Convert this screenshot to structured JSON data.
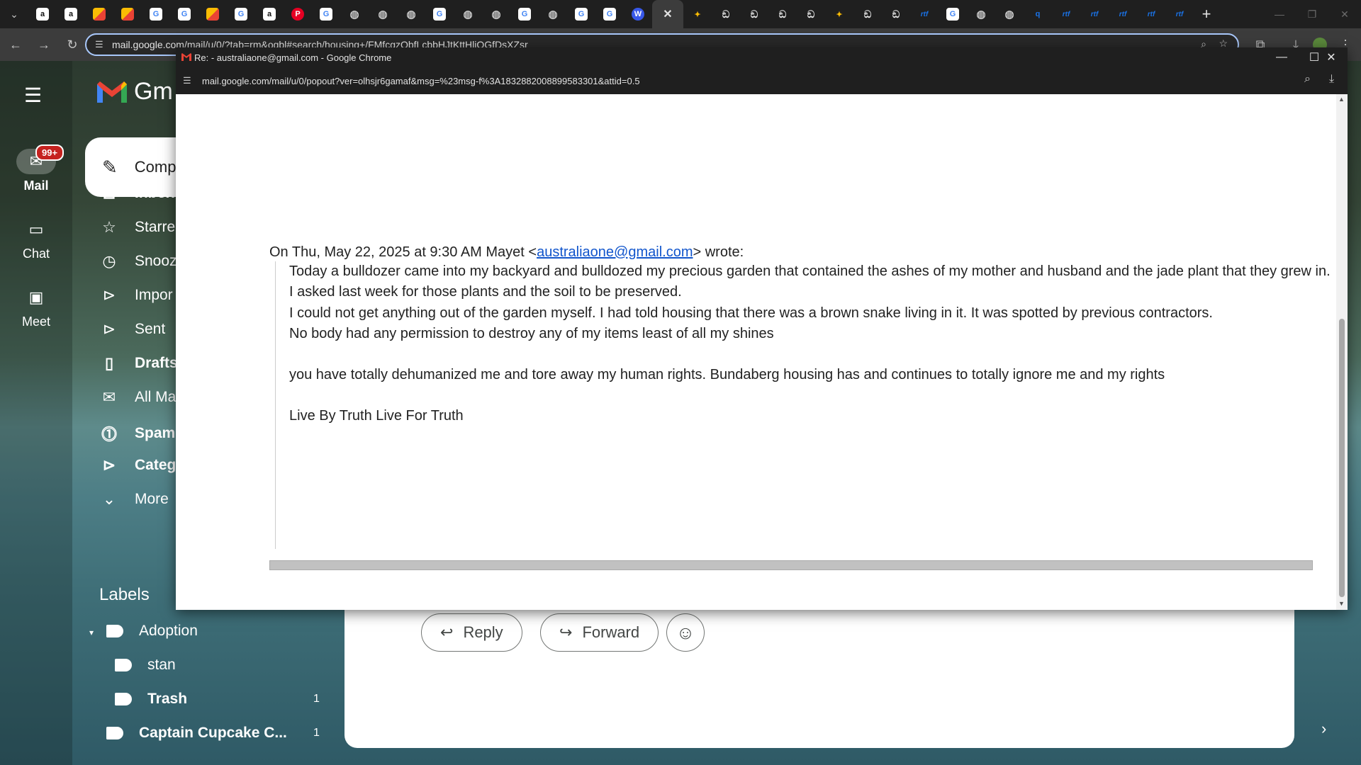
{
  "browser": {
    "tabs": [
      {
        "icon": "amazon-icon",
        "label": "a",
        "color": "#111111"
      },
      {
        "icon": "amazon-icon",
        "label": "a",
        "color": "#111111"
      },
      {
        "icon": "photos-icon",
        "label": "",
        "color": "#f4b400"
      },
      {
        "icon": "photos-icon",
        "label": "",
        "color": "#f4b400"
      },
      {
        "icon": "google-icon",
        "label": "G",
        "color": "#ffffff"
      },
      {
        "icon": "google-icon",
        "label": "G",
        "color": "#ffffff"
      },
      {
        "icon": "photos-icon",
        "label": "",
        "color": "#f4b400"
      },
      {
        "icon": "google-icon",
        "label": "G",
        "color": "#ffffff"
      },
      {
        "icon": "amazon-icon",
        "label": "a",
        "color": "#111111"
      },
      {
        "icon": "pinterest-icon",
        "label": "P",
        "color": "#e60023"
      },
      {
        "icon": "google-icon",
        "label": "G",
        "color": "#ffffff"
      },
      {
        "icon": "globe-icon",
        "label": "◍",
        "color": "#5f6368"
      },
      {
        "icon": "globe-icon",
        "label": "◍",
        "color": "#5f6368"
      },
      {
        "icon": "globe-icon",
        "label": "◍",
        "color": "#5f6368"
      },
      {
        "icon": "google-icon",
        "label": "G",
        "color": "#ffffff"
      },
      {
        "icon": "globe-icon",
        "label": "◍",
        "color": "#5f6368"
      },
      {
        "icon": "globe-icon",
        "label": "◍",
        "color": "#5f6368"
      },
      {
        "icon": "google-icon",
        "label": "G",
        "color": "#ffffff"
      },
      {
        "icon": "globe-icon",
        "label": "◍",
        "color": "#5f6368"
      },
      {
        "icon": "google-icon",
        "label": "G",
        "color": "#ffffff"
      },
      {
        "icon": "google-icon",
        "label": "G",
        "color": "#ffffff"
      },
      {
        "icon": "wordpress-icon",
        "label": "W",
        "color": "#3858e9"
      }
    ],
    "active_tab_close": "✕",
    "tabs_after": [
      {
        "icon": "pinwheel-icon",
        "label": "✦",
        "color": "#fbbc04"
      },
      {
        "icon": "robot-icon",
        "label": "ඞ",
        "color": "#e3e3e3"
      },
      {
        "icon": "robot-icon",
        "label": "ඞ",
        "color": "#e3e3e3"
      },
      {
        "icon": "robot-icon",
        "label": "ඞ",
        "color": "#e3e3e3"
      },
      {
        "icon": "robot-icon",
        "label": "ඞ",
        "color": "#e3e3e3"
      },
      {
        "icon": "pinwheel-icon",
        "label": "✦",
        "color": "#fbbc04"
      },
      {
        "icon": "robot-icon",
        "label": "ඞ",
        "color": "#e3e3e3"
      },
      {
        "icon": "robot-icon",
        "label": "ඞ",
        "color": "#e3e3e3"
      },
      {
        "icon": "rtf-icon",
        "label": "rtf",
        "color": "#1a73e8"
      },
      {
        "icon": "google-icon",
        "label": "G",
        "color": "#ffffff"
      },
      {
        "icon": "globe-icon",
        "label": "◍",
        "color": "#5f6368"
      },
      {
        "icon": "globe-icon",
        "label": "◍",
        "color": "#5f6368"
      },
      {
        "icon": "search-q-icon",
        "label": "q",
        "color": "#1a73e8"
      },
      {
        "icon": "rtf-icon",
        "label": "rtf",
        "color": "#1a73e8"
      },
      {
        "icon": "rtf-icon",
        "label": "rtf",
        "color": "#1a73e8"
      },
      {
        "icon": "rtf-icon",
        "label": "rtf",
        "color": "#1a73e8"
      },
      {
        "icon": "rtf-icon",
        "label": "rtf",
        "color": "#1a73e8"
      },
      {
        "icon": "rtf-icon",
        "label": "rtf",
        "color": "#1a73e8"
      }
    ],
    "new_tab_label": "+",
    "url": "mail.google.com/mail/u/0/?tab=rm&ogbl#search/housing+/FMfcgzQbfLcbbHJtKttHljQGfDsXZsr"
  },
  "gmail": {
    "rail": {
      "mail_label": "Mail",
      "mail_badge": "99+",
      "chat_label": "Chat",
      "meet_label": "Meet"
    },
    "logo_text": "Gm",
    "compose_label": "Comp",
    "nav": [
      {
        "icon": "inbox-icon",
        "glyph": "⊡",
        "label": "Inbox",
        "bold": true
      },
      {
        "icon": "star-icon",
        "glyph": "☆",
        "label": "Starre",
        "bold": false
      },
      {
        "icon": "clock-icon",
        "glyph": "◷",
        "label": "Snooz",
        "bold": false
      },
      {
        "icon": "important-icon",
        "glyph": "⊳",
        "label": "Impor",
        "bold": false
      },
      {
        "icon": "send-icon",
        "glyph": "⊳",
        "label": "Sent",
        "bold": false
      },
      {
        "icon": "draft-icon",
        "glyph": "▯",
        "label": "Drafts",
        "bold": true
      },
      {
        "icon": "all-mail-icon",
        "glyph": "✉",
        "label": "All Ma",
        "bold": false
      },
      {
        "icon": "spam-icon",
        "glyph": "⓵",
        "label": "Spam",
        "bold": true
      },
      {
        "icon": "categories-icon",
        "glyph": "⊳",
        "label": "Categ",
        "bold": true
      },
      {
        "icon": "chevron-down-icon",
        "glyph": "⌄",
        "label": "More",
        "bold": false
      }
    ],
    "labels_heading": "Labels",
    "labels": [
      {
        "label": "Adoption",
        "count": ""
      },
      {
        "label": "stan",
        "count": ""
      },
      {
        "label": "Trash",
        "count": "1"
      },
      {
        "label": "Captain Cupcake C...",
        "count": "1"
      }
    ],
    "reply_label": "Reply",
    "forward_label": "Forward"
  },
  "popup": {
    "title": "Re: - australiaone@gmail.com - Google Chrome",
    "url": "mail.google.com/mail/u/0/popout?ver=olhsjr6gamaf&msg=%23msg-f%3A1832882008899583301&attid=0.5",
    "quote_intro_before": "On Thu, May 22, 2025 at 9:30 AM Mayet <",
    "quote_email": "australiaone@gmail.com",
    "quote_intro_after": "> wrote:",
    "lines": [
      "Today a bulldozer came into my backyard and bulldozed my precious garden that contained the ashes of my mother and husband and the jade plant that they grew in.",
      "I asked last week for those plants and the soil to be preserved.",
      "I could not get anything out of the garden myself. I had told housing that there was a brown snake living in it. It was spotted by previous contractors.",
      "No body had any permission to destroy any of my items least of all my shines"
    ],
    "line_rights": "you have totally dehumanized me and tore away my human rights. Bundaberg housing has and continues to totally ignore me and my rights",
    "signature": "Live By Truth Live For Truth"
  }
}
